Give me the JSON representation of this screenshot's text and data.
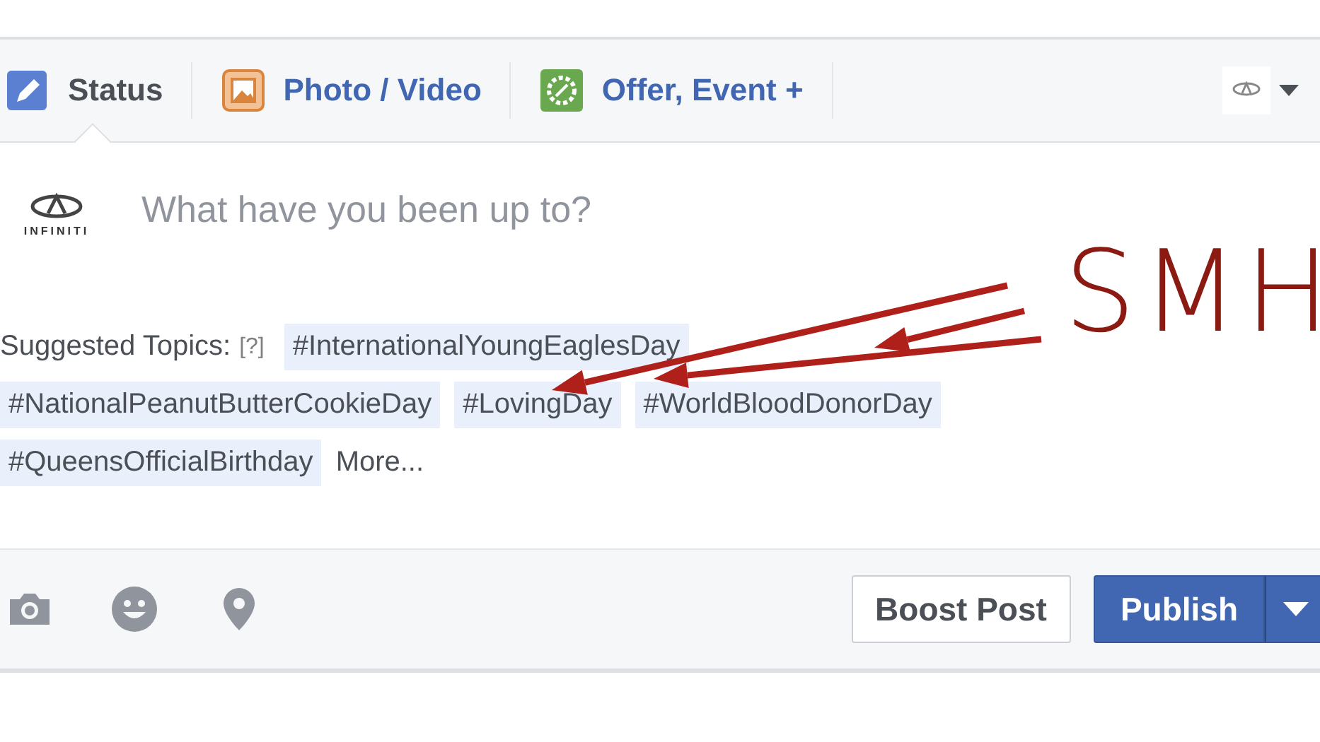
{
  "tabs": [
    {
      "label": "Status",
      "kind": "status",
      "selected": true
    },
    {
      "label": "Photo / Video",
      "kind": "photo",
      "selected": false
    },
    {
      "label": "Offer, Event +",
      "kind": "offer",
      "selected": false
    }
  ],
  "composer": {
    "placeholder": "What have you been up to?",
    "avatar_text": "INFINITI"
  },
  "suggested_topics": {
    "label": "Suggested Topics:",
    "help": "[?]",
    "topics": [
      "#InternationalYoungEaglesDay",
      "#NationalPeanutButterCookieDay",
      "#LovingDay",
      "#WorldBloodDonorDay",
      "#QueensOfficialBirthday"
    ],
    "more": "More..."
  },
  "buttons": {
    "boost": "Boost Post",
    "publish": "Publish"
  },
  "annotation": {
    "text": "SMH"
  }
}
